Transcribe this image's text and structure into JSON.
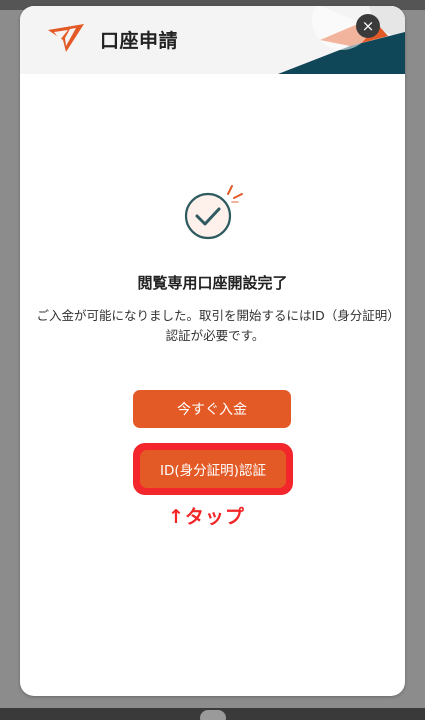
{
  "header": {
    "title": "口座申請",
    "close_symbol": "×",
    "logo_icon": "brand-arrow-logo-icon",
    "close_icon": "close-icon"
  },
  "status": {
    "icon": "check-circle-icon",
    "title": "閲覧専用口座開設完了",
    "message": "ご入金が可能になりました。取引を開始するにはID（身分証明）認証が必要です。"
  },
  "buttons": {
    "deposit_label": "今すぐ入金",
    "id_auth_label": "ID(身分証明)認証"
  },
  "annotation": {
    "tap_label": "↑タップ"
  },
  "colors": {
    "brand_orange": "#e45a26",
    "highlight_red": "#f3262b",
    "annotation_red": "#f22626",
    "check_teal": "#2f5a5f"
  }
}
